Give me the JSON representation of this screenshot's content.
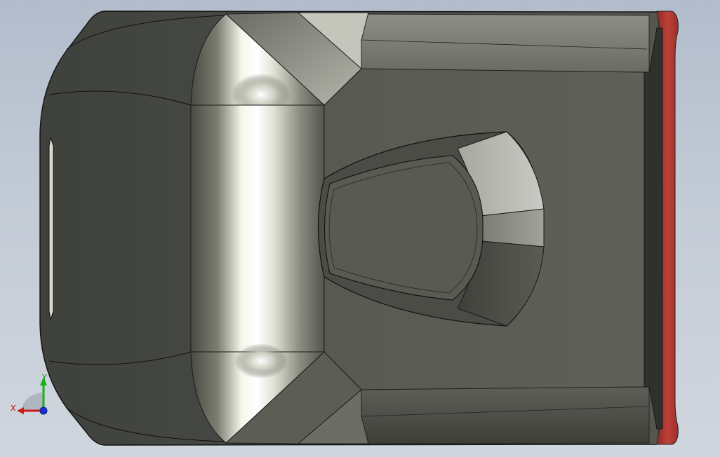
{
  "viewport": {
    "background_top": "#b2bccb",
    "background_bottom": "#d0d6de"
  },
  "model": {
    "body_color": "#55574f",
    "edge_color": "#111111",
    "highlight_color": "#f4f6e8",
    "flange_color": "#b03a32"
  },
  "triad": {
    "x_label": "X",
    "y_label": "Y",
    "x_color": "#d01818",
    "y_color": "#18b018",
    "z_color": "#1a30d0"
  }
}
